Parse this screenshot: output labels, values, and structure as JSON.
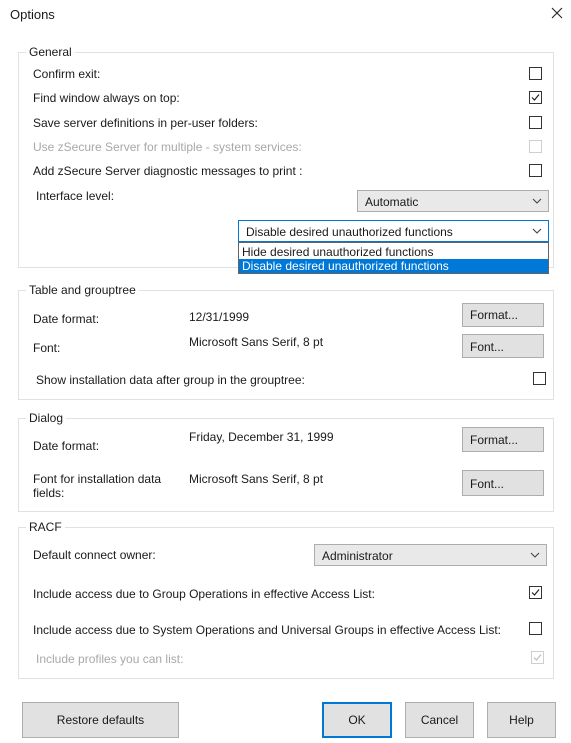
{
  "window": {
    "title": "Options"
  },
  "general": {
    "legend": "General",
    "confirm_exit": {
      "label": "Confirm exit:",
      "checked": false
    },
    "find_window_on_top": {
      "label": "Find window always on top:",
      "checked": true
    },
    "save_server_definitions": {
      "label": "Save server definitions in per-user folders:",
      "checked": false
    },
    "use_zsecure_server": {
      "label": "Use zSecure Server for multiple - system services:",
      "checked": false,
      "disabled": true
    },
    "add_diagnostic_messages": {
      "label": "Add zSecure Server diagnostic messages to print :",
      "checked": false
    },
    "interface_level": {
      "label": "Interface level:",
      "value": "Automatic"
    },
    "unauthorized_functions": {
      "value": "Disable desired unauthorized functions",
      "options": [
        "Hide desired unauthorized functions",
        "Disable desired unauthorized functions"
      ],
      "selected_index": 1
    }
  },
  "table_grouptree": {
    "legend": "Table and grouptree",
    "date_format": {
      "label": "Date format:",
      "value": "12/31/1999",
      "button": "Format..."
    },
    "font": {
      "label": "Font:",
      "value": "Microsoft Sans Serif, 8 pt",
      "button": "Font..."
    },
    "show_installation_data": {
      "label": "Show installation data after group in the grouptree:",
      "checked": false
    }
  },
  "dialog": {
    "legend": "Dialog",
    "date_format": {
      "label": "Date format:",
      "value": "Friday, December 31, 1999",
      "button": "Format..."
    },
    "font_installation": {
      "label_line1": "Font for installation data",
      "label_line2": "fields:",
      "value": "Microsoft Sans Serif, 8 pt",
      "button": "Font..."
    }
  },
  "racf": {
    "legend": "RACF",
    "default_connect_owner": {
      "label": "Default connect owner:",
      "value": "Administrator"
    },
    "include_group_operations": {
      "label": "Include access due to Group Operations in effective Access List:",
      "checked": true
    },
    "include_system_operations": {
      "label": "Include access due to System Operations and Universal Groups in effective Access List:",
      "checked": false
    },
    "include_profiles": {
      "label": "Include profiles you can list:",
      "checked": true,
      "disabled": true
    }
  },
  "footer": {
    "restore_defaults": "Restore defaults",
    "ok": "OK",
    "cancel": "Cancel",
    "help": "Help"
  },
  "colors": {
    "accent": "#0078d7",
    "group_border": "#e1e1e1",
    "button_face": "#e1e1e1",
    "disabled_text": "#a8a8a8"
  },
  "icons": {
    "close": "close-icon",
    "check": "checkmark-icon",
    "dropdown": "chevron-down-icon"
  }
}
